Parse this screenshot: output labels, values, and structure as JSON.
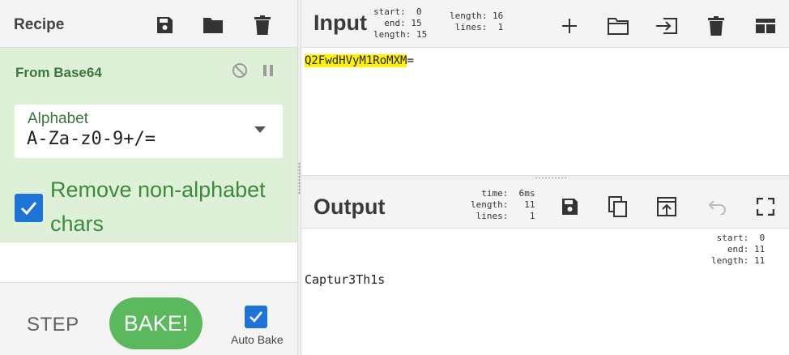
{
  "recipe": {
    "title": "Recipe",
    "icons": [
      "save-icon",
      "folder-icon",
      "trash-icon"
    ]
  },
  "operation": {
    "name": "From Base64",
    "alphabet_label": "Alphabet",
    "alphabet_value": "A-Za-z0-9+/=",
    "remove_non_alphabet_label": "Remove non-alphabet chars",
    "remove_non_alphabet_checked": true
  },
  "footer": {
    "step_label": "STEP",
    "bake_label": "BAKE!",
    "auto_bake_label": "Auto Bake",
    "auto_bake_checked": true
  },
  "input": {
    "title": "Input",
    "stats_sel": "start:  0\n  end: 15\nlength: 15",
    "stats_len": "length: 16\n lines:  1",
    "text_highlighted": "Q2FwdHVyM1RoMXM",
    "text_rest": "="
  },
  "output": {
    "title": "Output",
    "stats": "  time:  6ms\nlength:   11\n lines:    1",
    "sel_stats": " start:  0\n   end: 11\nlength: 11",
    "text": "Captur3Th1s"
  },
  "colors": {
    "accent_blue": "#1e73d6",
    "bake_green": "#5cb85c",
    "op_background": "#dff0d8",
    "op_text": "#3c763d",
    "highlight": "#fff200"
  }
}
